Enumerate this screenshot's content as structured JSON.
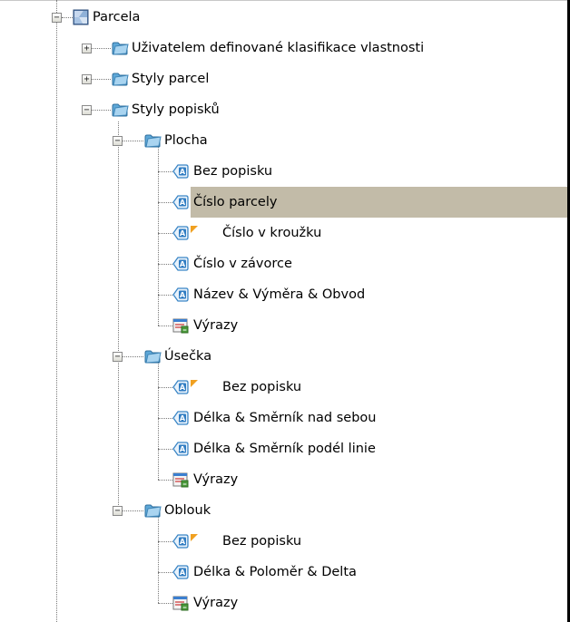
{
  "tree": {
    "root": {
      "label": "Parcela",
      "expanded": true,
      "icon": "parcel-collection-icon"
    },
    "items": [
      {
        "id": "uzivatelem",
        "label": "Uživatelem definované klasifikace vlastnosti",
        "level": 1,
        "icon": "folder-icon",
        "expander": "plus"
      },
      {
        "id": "styly-parcel",
        "label": "Styly parcel",
        "level": 1,
        "icon": "folder-icon",
        "expander": "plus"
      },
      {
        "id": "styly-popisku",
        "label": "Styly popisků",
        "level": 1,
        "icon": "folder-icon",
        "expander": "minus"
      },
      {
        "id": "plocha",
        "label": "Plocha",
        "level": 2,
        "icon": "folder-icon",
        "expander": "minus"
      },
      {
        "id": "plocha-bez-popisku",
        "label": "Bez popisku",
        "level": 3,
        "icon": "label-style-icon"
      },
      {
        "id": "plocha-cislo-parcely",
        "label": "Číslo parcely",
        "level": 3,
        "icon": "label-style-icon",
        "selected": true
      },
      {
        "id": "plocha-cislo-v-krouzku",
        "label": "Číslo v kroužku",
        "level": 3,
        "icon": "label-style-icon",
        "flag": true
      },
      {
        "id": "plocha-cislo-v-zavorce",
        "label": "Číslo v závorce",
        "level": 3,
        "icon": "label-style-icon"
      },
      {
        "id": "plocha-nazev",
        "label": "Název & Výměra & Obvod",
        "level": 3,
        "icon": "label-style-icon"
      },
      {
        "id": "plocha-vyrazy",
        "label": "Výrazy",
        "level": 3,
        "icon": "expressions-icon"
      },
      {
        "id": "usecka",
        "label": "Úsečka",
        "level": 2,
        "icon": "folder-icon",
        "expander": "minus"
      },
      {
        "id": "usecka-bez-popisku",
        "label": "Bez popisku",
        "level": 3,
        "icon": "label-style-icon",
        "flag": true
      },
      {
        "id": "usecka-nad-sebou",
        "label": "Délka & Směrník nad sebou",
        "level": 3,
        "icon": "label-style-icon"
      },
      {
        "id": "usecka-podel-linie",
        "label": "Délka & Směrník podél linie",
        "level": 3,
        "icon": "label-style-icon"
      },
      {
        "id": "usecka-vyrazy",
        "label": "Výrazy",
        "level": 3,
        "icon": "expressions-icon"
      },
      {
        "id": "oblouk",
        "label": "Oblouk",
        "level": 2,
        "icon": "folder-icon",
        "expander": "minus"
      },
      {
        "id": "oblouk-bez-popisku",
        "label": "Bez popisku",
        "level": 3,
        "icon": "label-style-icon",
        "flag": true
      },
      {
        "id": "oblouk-delka",
        "label": "Délka & Poloměr & Delta",
        "level": 3,
        "icon": "label-style-icon"
      },
      {
        "id": "oblouk-vyrazy",
        "label": "Výrazy",
        "level": 3,
        "icon": "expressions-icon"
      }
    ]
  },
  "colors": {
    "selection": "#c2bba8",
    "folder": "#7ab8e0",
    "flag": "#f0a020",
    "label_icon": "#3b86c6"
  }
}
